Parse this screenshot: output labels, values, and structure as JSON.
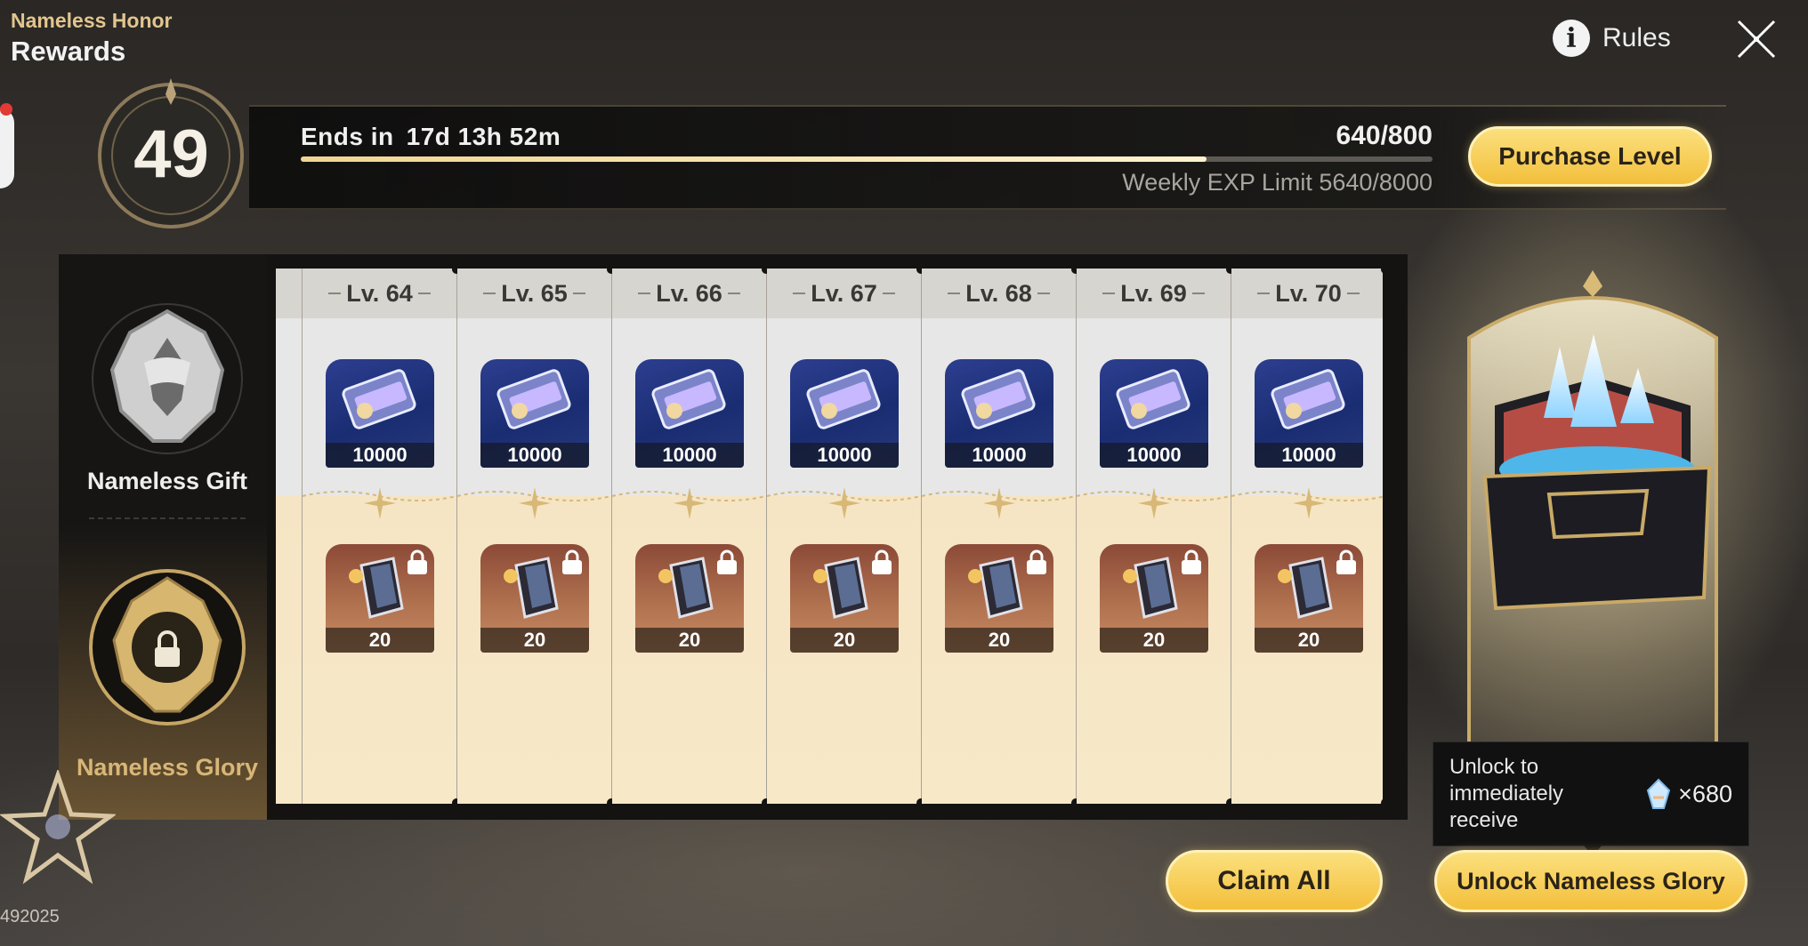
{
  "header": {
    "subtitle": "Nameless Honor",
    "title": "Rewards",
    "rules_label": "Rules"
  },
  "progress": {
    "level": "49",
    "ends_label": "Ends in",
    "ends_value": "17d 13h 52m",
    "exp": "640/800",
    "exp_fraction": 0.8,
    "weekly_limit": "Weekly EXP Limit 5640/8000",
    "purchase_label": "Purchase Level"
  },
  "tracks": {
    "gift_label": "Nameless Gift",
    "glory_label": "Nameless Glory"
  },
  "levels": [
    {
      "label": "Lv. 64",
      "gift_qty": "10000",
      "glory_qty": "20"
    },
    {
      "label": "Lv. 65",
      "gift_qty": "10000",
      "glory_qty": "20"
    },
    {
      "label": "Lv. 66",
      "gift_qty": "10000",
      "glory_qty": "20"
    },
    {
      "label": "Lv. 67",
      "gift_qty": "10000",
      "glory_qty": "20"
    },
    {
      "label": "Lv. 68",
      "gift_qty": "10000",
      "glory_qty": "20"
    },
    {
      "label": "Lv. 69",
      "gift_qty": "10000",
      "glory_qty": "20"
    },
    {
      "label": "Lv. 70",
      "gift_qty": "10000",
      "glory_qty": "20"
    }
  ],
  "unlock_panel": {
    "tooltip_text": "Unlock to immediately receive",
    "tooltip_amount": "×680",
    "unlock_label": "Unlock Nameless Glory"
  },
  "claim_label": "Claim All",
  "uid": "492025",
  "colors": {
    "gold_button": "#f7cf55",
    "gift_bg": "#e7e7e7",
    "glory_bg": "#f7e8c8",
    "accent": "#e2c58f"
  }
}
